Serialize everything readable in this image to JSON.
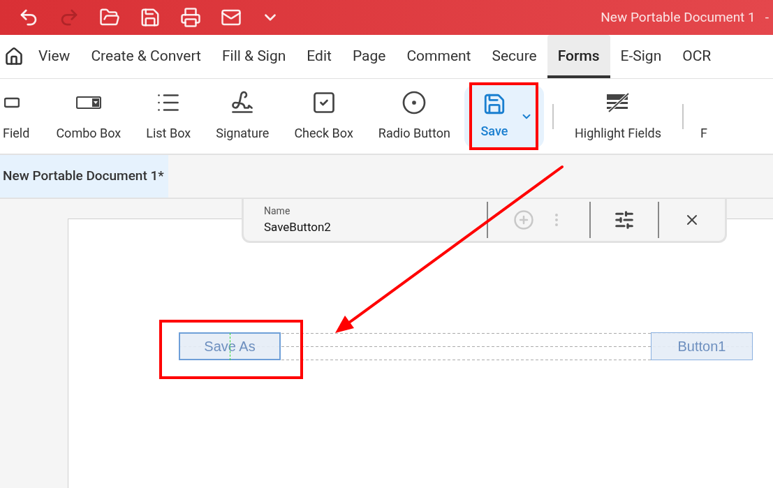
{
  "title_bar": {
    "title": "New Portable Document 1",
    "window_controls": [
      "-"
    ]
  },
  "menu_tabs": [
    {
      "label": "View",
      "selected": false
    },
    {
      "label": "Create & Convert",
      "selected": false
    },
    {
      "label": "Fill & Sign",
      "selected": false
    },
    {
      "label": "Edit",
      "selected": false
    },
    {
      "label": "Page",
      "selected": false
    },
    {
      "label": "Comment",
      "selected": false
    },
    {
      "label": "Secure",
      "selected": false
    },
    {
      "label": "Forms",
      "selected": true
    },
    {
      "label": "E-Sign",
      "selected": false
    },
    {
      "label": "OCR",
      "selected": false
    }
  ],
  "ribbon": [
    {
      "kind": "tool",
      "label": "Field",
      "selected": false
    },
    {
      "kind": "tool",
      "label": "Combo Box",
      "selected": false
    },
    {
      "kind": "tool",
      "label": "List Box",
      "selected": false
    },
    {
      "kind": "tool",
      "label": "Signature",
      "selected": false
    },
    {
      "kind": "tool",
      "label": "Check Box",
      "selected": false
    },
    {
      "kind": "tool",
      "label": "Radio Button",
      "selected": false
    },
    {
      "kind": "split",
      "label": "Save",
      "selected": true
    },
    {
      "kind": "separator"
    },
    {
      "kind": "tool",
      "label": "Highlight Fields",
      "selected": false
    },
    {
      "kind": "separator"
    },
    {
      "kind": "tool",
      "label": "F",
      "selected": false
    }
  ],
  "document_tabs": [
    {
      "label": "New Portable Document 1*",
      "selected": true
    }
  ],
  "field_toolbar": {
    "name_label": "Name",
    "name_value": "SaveButton2"
  },
  "form_fields": [
    {
      "label": "Save As",
      "selected": true
    },
    {
      "label": "Button1",
      "selected": false
    }
  ]
}
